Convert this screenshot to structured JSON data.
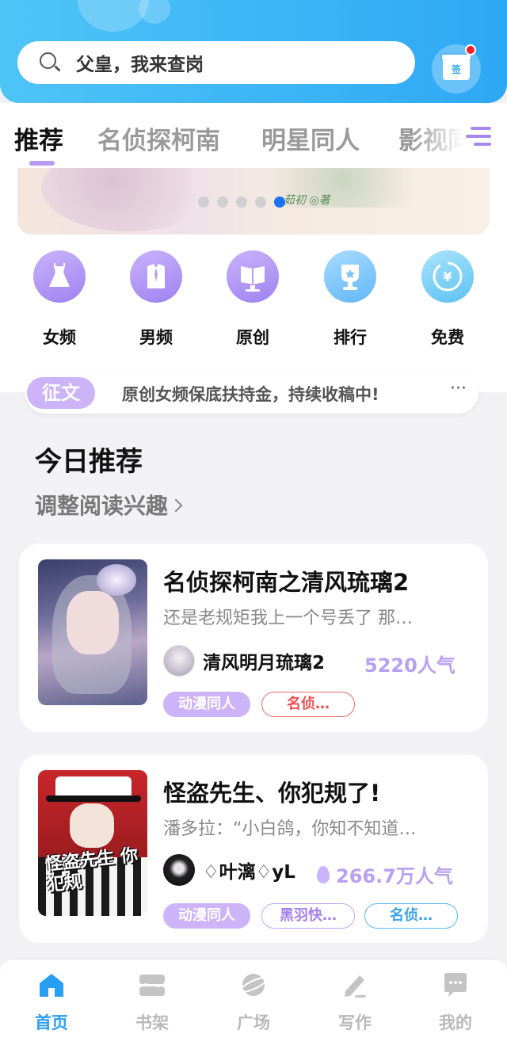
{
  "search": {
    "placeholder_text": "父皇，我来查岗"
  },
  "signin": {
    "label": "签"
  },
  "tabs": [
    {
      "label": "推荐",
      "active": true
    },
    {
      "label": "名侦探柯南",
      "active": false
    },
    {
      "label": "明星同人",
      "active": false
    },
    {
      "label": "影视同",
      "active": false
    }
  ],
  "banner": {
    "signature": "茹初 ◎著",
    "page_count": 5,
    "current_page": 5
  },
  "categories": [
    {
      "label": "女频",
      "icon": "dress-icon"
    },
    {
      "label": "男频",
      "icon": "shirt-icon"
    },
    {
      "label": "原创",
      "icon": "book-stand-icon"
    },
    {
      "label": "排行",
      "icon": "trophy-icon"
    },
    {
      "label": "免费",
      "icon": "yen-coin-icon"
    }
  ],
  "notice": {
    "badge": "征文",
    "text": "原创女频保底扶持金，持续收稿中!",
    "more": "···"
  },
  "today": {
    "title": "今日推荐",
    "adjust": "调整阅读兴趣"
  },
  "books": [
    {
      "title": "名侦探柯南之清风琉璃2",
      "desc": "还是老规矩我上一个号丢了 那…",
      "author": "清风明月琉璃2",
      "popularity": "5220人气",
      "tags": [
        "动漫同人",
        "名侦…"
      ]
    },
    {
      "title": "怪盗先生、你犯规了!",
      "desc": "潘多拉：“小白鸽，你知不知道…",
      "author": "♢叶漓♢yL",
      "popularity": "266.7万人气",
      "cover_title": "怪盗先生 你犯规",
      "tags": [
        "动漫同人",
        "黑羽快…",
        "名侦…"
      ]
    }
  ],
  "bottom_nav": [
    {
      "label": "首页",
      "active": true
    },
    {
      "label": "书架",
      "active": false
    },
    {
      "label": "广场",
      "active": false
    },
    {
      "label": "写作",
      "active": false
    },
    {
      "label": "我的",
      "active": false
    }
  ],
  "colors": {
    "accent_blue": "#2a9ef2",
    "accent_purple": "#cdb3f7",
    "tag_red": "#ef4e4e"
  }
}
